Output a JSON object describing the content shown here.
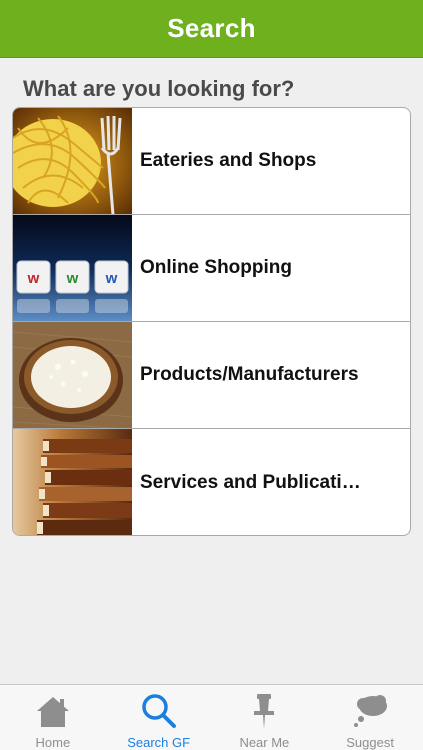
{
  "navbar": {
    "title": "Search"
  },
  "heading": "What are you looking for?",
  "categories": [
    {
      "label": "Eateries and Shops",
      "icon": "spaghetti-fork-image"
    },
    {
      "label": "Online Shopping",
      "icon": "www-keys-image"
    },
    {
      "label": "Products/Manufacturers",
      "icon": "rice-bowl-image"
    },
    {
      "label": "Services and Publicati…",
      "icon": "book-stack-image"
    }
  ],
  "tabbar": {
    "tabs": [
      {
        "label": "Home",
        "icon": "house-icon",
        "active": false
      },
      {
        "label": "Search GF",
        "icon": "magnifier-icon",
        "active": true
      },
      {
        "label": "Near Me",
        "icon": "pushpin-icon",
        "active": false
      },
      {
        "label": "Suggest",
        "icon": "thought-bubble-icon",
        "active": false
      }
    ]
  },
  "colors": {
    "navbar": "#6eb01e",
    "active_tab": "#1a7fe0",
    "inactive_tab": "#8e8e8e"
  }
}
